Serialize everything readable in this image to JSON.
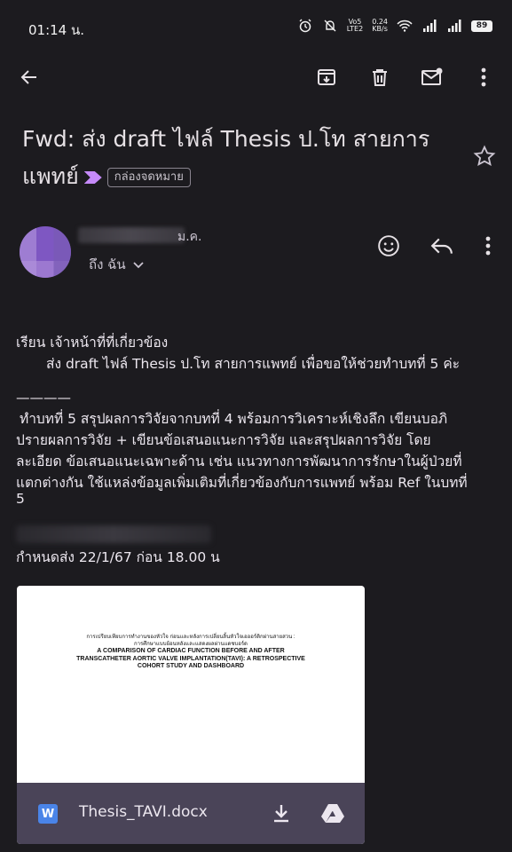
{
  "status_bar": {
    "time": "01:14 น.",
    "network_top": "Vo5",
    "network_bottom": "LTE2",
    "speed_top": "0.24",
    "speed_bottom": "KB/s",
    "battery": "89"
  },
  "toolbar": {
    "icons": [
      "back-arrow-icon",
      "archive-icon",
      "delete-icon",
      "mark-unread-icon",
      "more-vert-icon"
    ]
  },
  "email": {
    "subject": "Fwd: ส่ง draft ไฟล์ Thesis ป.โท สายการแพทย์",
    "label": "กล่องจดหมาย",
    "importance_color": "#c58af9",
    "sender_date": "ม.ค.",
    "to_line": "ถึง ฉัน",
    "body": {
      "greeting": "เรียน เจ้าหน้าที่ที่เกี่ยวข้อง",
      "line2": "ส่ง draft ไฟล์ Thesis ป.โท สายการแพทย์ เพื่อขอให้ช่วยทำบทที่ 5 ค่ะ",
      "separator": "————",
      "para_1": "ทำบทที่ 5 สรุปผลการวิจัยจากบทที่ 4 พร้อมการวิเคราะห์เชิงลึก เขียนบอภิ",
      "para_2": "ปรายผลการวิจัย + เขียนข้อเสนอแนะการวิจัย และสรุปผลการวิจัย โดย",
      "para_3": "ละเอียด ข้อเสนอแนะเฉพาะด้าน เช่น แนวทางการพัฒนาการรักษาในผู้ป่วยที่",
      "para_4": "แตกต่างกัน ใช้แหล่งข้อมูลเพิ่มเติมที่เกี่ยวข้องกับการแพทย์ พร้อม Ref ในบทที่",
      "para_5": "5",
      "deadline": "กำหนดส่ง 22/1/67 ก่อน 18.00 น"
    },
    "attachment": {
      "file_name": "Thesis_TAVI.docx",
      "type_letter": "W",
      "preview": {
        "line1": "การเปรียบเทียบการทำงานของหัวใจ ก่อนและหลังการเปลี่ยนลิ้นหัวใจเอออร์ติกผ่านสายสวน :",
        "line2": "การศึกษาแบบย้อนหลังและแสดงผลผ่านแดชบอร์ด",
        "line3": "A COMPARISON OF CARDIAC FUNCTION BEFORE AND AFTER",
        "line4": "TRANSCATHETER AORTIC VALVE IMPLANTATION(TAVI): A RETROSPECTIVE",
        "line5": "COHORT STUDY AND DASHBOARD"
      }
    }
  }
}
